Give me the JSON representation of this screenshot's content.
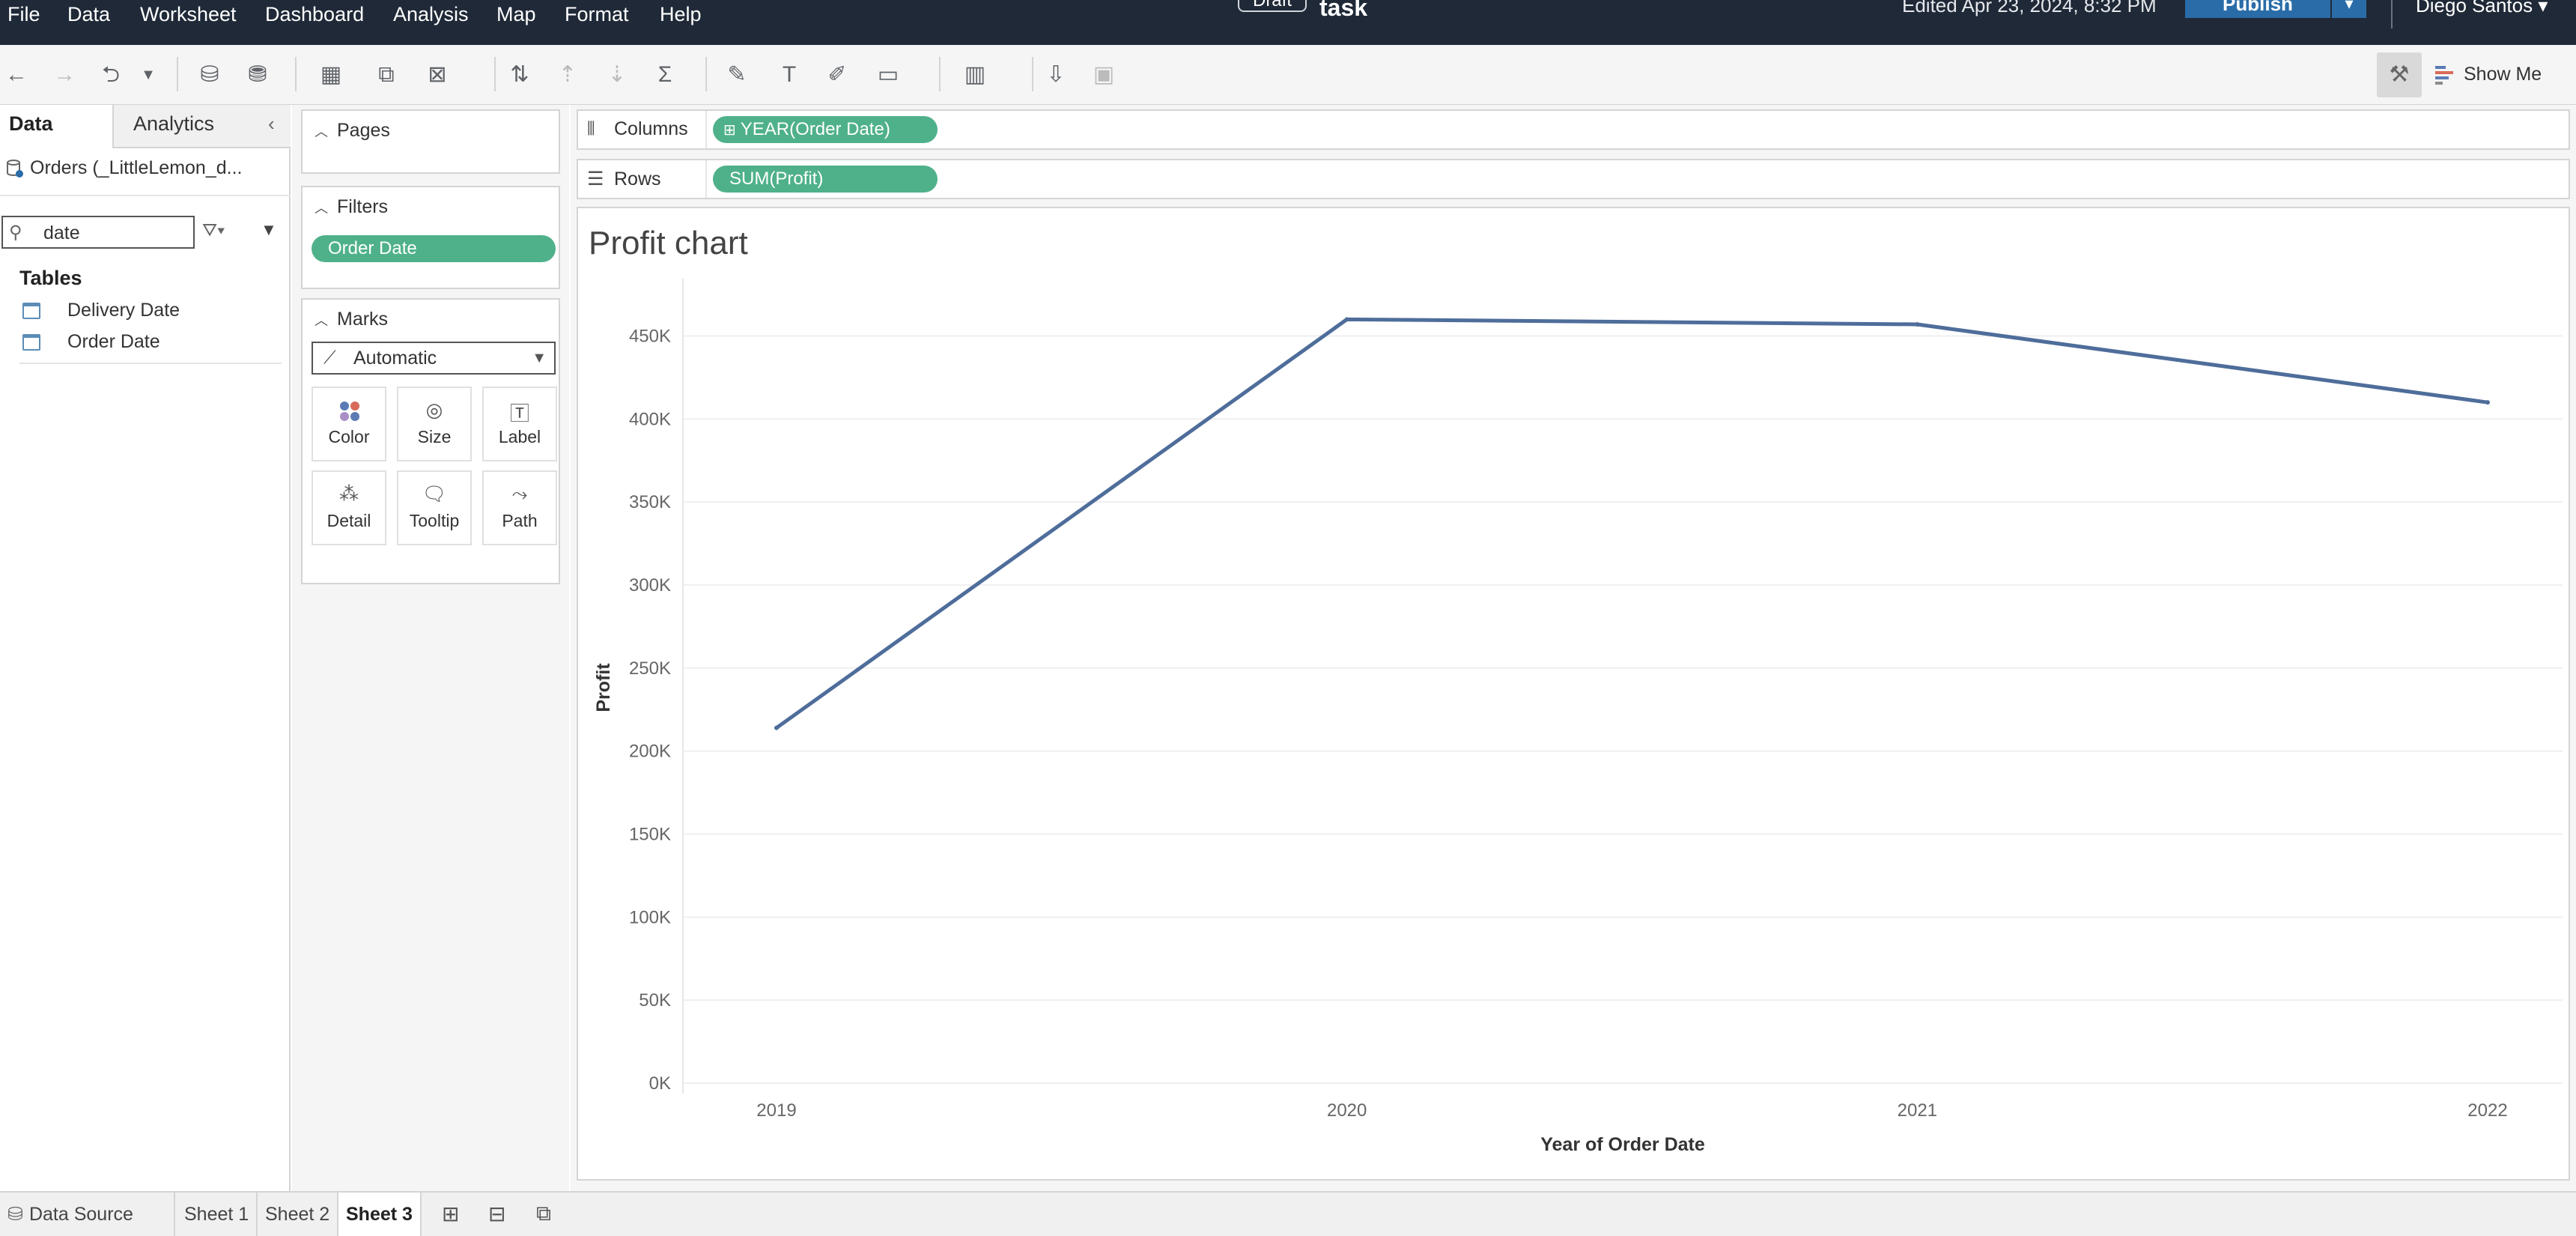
{
  "menu": [
    "File",
    "Data",
    "Worksheet",
    "Dashboard",
    "Analysis",
    "Map",
    "Format",
    "Help"
  ],
  "header": {
    "draft_badge": "Draft",
    "title": "task",
    "edited": "Edited Apr 23, 2024, 8:32 PM",
    "publish": "Publish",
    "user": "Diego Santos"
  },
  "toolbar": {
    "show_me": "Show Me"
  },
  "datapane": {
    "tab_data": "Data",
    "tab_analytics": "Analytics",
    "datasource": "Orders (_LittleLemon_d...",
    "search_value": "date",
    "tables_heading": "Tables",
    "fields": [
      "Delivery Date",
      "Order Date"
    ]
  },
  "cards": {
    "pages": "Pages",
    "filters": "Filters",
    "filter_pill": "Order Date",
    "marks": "Marks",
    "mark_type": "Automatic",
    "mark_buttons": [
      "Color",
      "Size",
      "Label",
      "Detail",
      "Tooltip",
      "Path"
    ]
  },
  "shelves": {
    "columns_label": "Columns",
    "columns_pill": "YEAR(Order Date)",
    "rows_label": "Rows",
    "rows_pill": "SUM(Profit)"
  },
  "chart_data": {
    "type": "line",
    "title": "Profit chart",
    "xlabel": "Year of Order Date",
    "ylabel": "Profit",
    "categories": [
      "2019",
      "2020",
      "2021",
      "2022"
    ],
    "values": [
      214000,
      460000,
      457000,
      410000
    ],
    "ylim": [
      0,
      480000
    ],
    "yticks": [
      0,
      50000,
      100000,
      150000,
      200000,
      250000,
      300000,
      350000,
      400000,
      450000
    ],
    "ytick_labels": [
      "0K",
      "50K",
      "100K",
      "150K",
      "200K",
      "250K",
      "300K",
      "350K",
      "400K",
      "450K"
    ],
    "grid": true,
    "line_color": "#4e6d9a"
  },
  "sheets": {
    "data_source": "Data Source",
    "tabs": [
      "Sheet 1",
      "Sheet 2",
      "Sheet 3"
    ],
    "active": "Sheet 3"
  }
}
